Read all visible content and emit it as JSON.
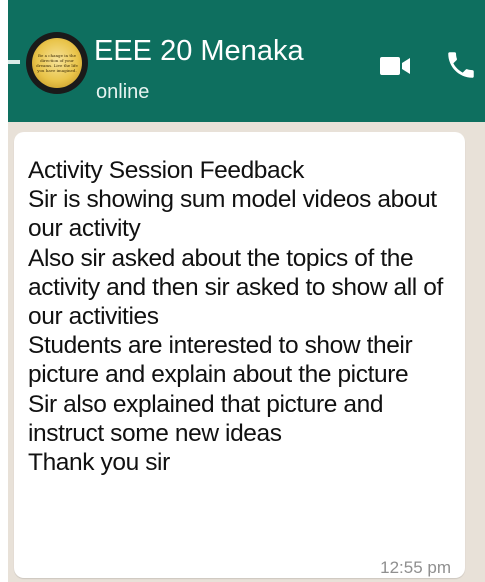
{
  "header": {
    "contact_name": "EEE 20 Menaka",
    "status": "online",
    "avatar_text": "Be a change in the direction of your dreams. Live the life you have imagined.",
    "icons": {
      "video": "video-call-icon",
      "call": "phone-call-icon"
    },
    "colors": {
      "header_bg": "#0e6f5f",
      "text": "#ffffff"
    }
  },
  "message": {
    "text": "Activity Session Feedback\nSir is showing sum model videos about our activity\nAlso sir asked about the topics of the activity and then sir asked to show all of our activities\nStudents are interested to show their picture and explain about the picture\nSir also explained that picture and instruct some new ideas\nThank you sir",
    "time": "12:55 pm"
  }
}
